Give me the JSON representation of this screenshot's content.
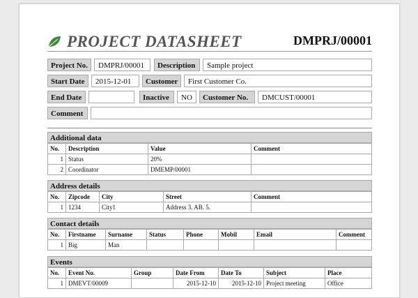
{
  "header": {
    "title": "PROJECT DATASHEET",
    "doc_no": "DMPRJ/00001",
    "logo_icon": "leaf-icon"
  },
  "fields": {
    "project_no_label": "Project No.",
    "project_no": "DMPRJ/00001",
    "description_label": "Description",
    "description": "Sample project",
    "start_date_label": "Start Date",
    "start_date": "2015-12-01",
    "customer_label": "Customer",
    "customer": "First Customer Co.",
    "end_date_label": "End Date",
    "end_date": "",
    "inactive_label": "Inactive",
    "inactive": "NO",
    "customer_no_label": "Customer No.",
    "customer_no": "DMCUST/00001",
    "comment_label": "Comment",
    "comment": ""
  },
  "additional": {
    "title": "Additional data",
    "headers": [
      "No.",
      "Description",
      "Value",
      "Comment"
    ],
    "rows": [
      [
        "1",
        "Status",
        "20%",
        ""
      ],
      [
        "2",
        "Coordinator",
        "DMEMP/00001",
        ""
      ]
    ]
  },
  "address": {
    "title": "Address details",
    "headers": [
      "No.",
      "Zipcode",
      "City",
      "Street",
      "Comment"
    ],
    "rows": [
      [
        "1",
        "1234",
        "City1",
        "Address 3. AB. 5.",
        ""
      ]
    ]
  },
  "contact": {
    "title": "Contact details",
    "headers": [
      "No.",
      "Firstname",
      "Surname",
      "Status",
      "Phone",
      "Mobil",
      "Email",
      "Comment"
    ],
    "rows": [
      [
        "1",
        "Big",
        "Man",
        "",
        "",
        "",
        "",
        ""
      ]
    ]
  },
  "events": {
    "title": "Events",
    "headers": [
      "No.",
      "Event No.",
      "Group",
      "Date From",
      "Date To",
      "Subject",
      "Place"
    ],
    "rows": [
      [
        "1",
        "DMEVT/00009",
        "",
        "2015-12-10",
        "2015-12-10",
        "Project meeting",
        "Office"
      ]
    ]
  }
}
